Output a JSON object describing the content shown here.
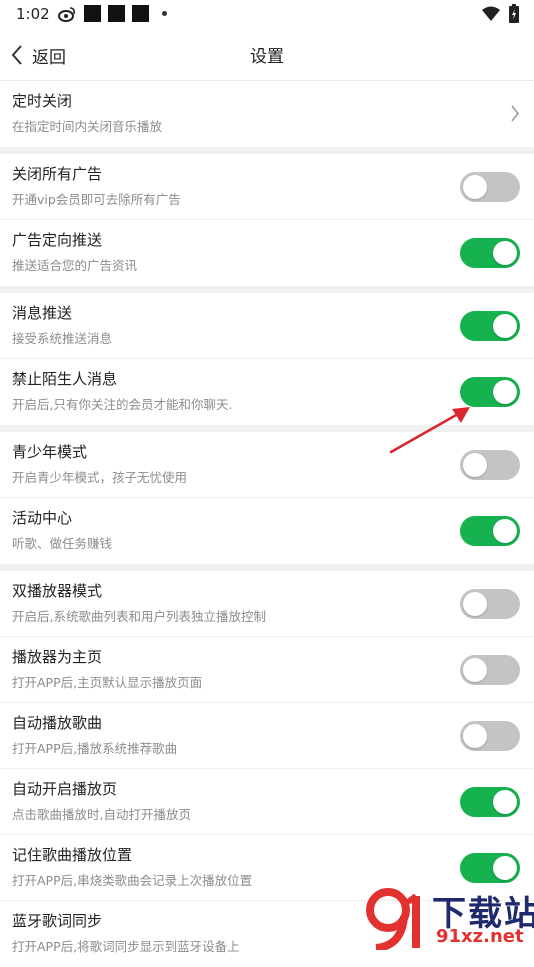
{
  "status_bar": {
    "time": "1:02"
  },
  "header": {
    "back_label": "返回",
    "title": "设置"
  },
  "colors": {
    "toggle_on": "#15b24f",
    "toggle_off": "#c4c4c4",
    "annotation_arrow": "#d9262c"
  },
  "settings": {
    "timer_close": {
      "title": "定时关闭",
      "desc": "在指定时间内关闭音乐播放"
    },
    "close_ads": {
      "title": "关闭所有广告",
      "desc": "开通vip会员即可去除所有广告",
      "enabled": false
    },
    "targeted_ads": {
      "title": "广告定向推送",
      "desc": "推送适合您的广告资讯",
      "enabled": true
    },
    "message_push": {
      "title": "消息推送",
      "desc": "接受系统推送消息",
      "enabled": true
    },
    "block_strangers": {
      "title": "禁止陌生人消息",
      "desc": "开启后,只有你关注的会员才能和你聊天.",
      "enabled": true
    },
    "teen_mode": {
      "title": "青少年模式",
      "desc": "开启青少年模式，孩子无忧使用",
      "enabled": false
    },
    "activity_center": {
      "title": "活动中心",
      "desc": "听歌、做任务赚钱",
      "enabled": true
    },
    "dual_player": {
      "title": "双播放器模式",
      "desc": "开启后,系统歌曲列表和用户列表独立播放控制",
      "enabled": false
    },
    "player_home": {
      "title": "播放器为主页",
      "desc": "打开APP后,主页默认显示播放页面",
      "enabled": false
    },
    "autoplay": {
      "title": "自动播放歌曲",
      "desc": "打开APP后,播放系统推荐歌曲",
      "enabled": false
    },
    "auto_open_player": {
      "title": "自动开启播放页",
      "desc": "点击歌曲播放时,自动打开播放页",
      "enabled": true
    },
    "remember_position": {
      "title": "记住歌曲播放位置",
      "desc": "打开APP后,串烧类歌曲会记录上次播放位置",
      "enabled": true
    },
    "bt_lyrics": {
      "title": "蓝牙歌词同步",
      "desc": "打开APP后,将歌词同步显示到蓝牙设备上"
    }
  },
  "watermark": {
    "brand": "下载站",
    "url": "91xz.net"
  }
}
